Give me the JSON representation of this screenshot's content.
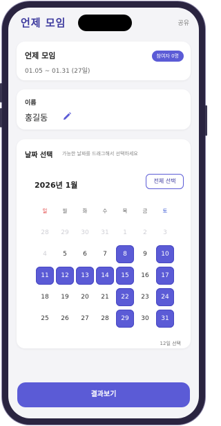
{
  "app": {
    "logo": "언제 모임",
    "share_label": "공유"
  },
  "event": {
    "title": "언제 모임",
    "range": "01.05 ~ 01.31 (27일)",
    "participants_badge": "참여자 0명"
  },
  "name": {
    "label": "이름",
    "value": "홍길동"
  },
  "date_select": {
    "title": "날짜 선택",
    "hint": "가능한 날짜를 드래그해서 선택하세요",
    "month": "2026년 1월",
    "select_all_label": "전체 선택",
    "weekdays": [
      "일",
      "월",
      "화",
      "수",
      "목",
      "금",
      "토"
    ],
    "weeks": [
      [
        {
          "d": "28",
          "state": "faded"
        },
        {
          "d": "29",
          "state": "faded"
        },
        {
          "d": "30",
          "state": "faded"
        },
        {
          "d": "31",
          "state": "faded"
        },
        {
          "d": "1",
          "state": "faded"
        },
        {
          "d": "2",
          "state": "faded"
        },
        {
          "d": "3",
          "state": "faded"
        }
      ],
      [
        {
          "d": "4",
          "state": "faded"
        },
        {
          "d": "5",
          "state": "normal"
        },
        {
          "d": "6",
          "state": "normal"
        },
        {
          "d": "7",
          "state": "normal"
        },
        {
          "d": "8",
          "state": "selected"
        },
        {
          "d": "9",
          "state": "normal"
        },
        {
          "d": "10",
          "state": "selected"
        }
      ],
      [
        {
          "d": "11",
          "state": "selected"
        },
        {
          "d": "12",
          "state": "selected"
        },
        {
          "d": "13",
          "state": "selected"
        },
        {
          "d": "14",
          "state": "selected"
        },
        {
          "d": "15",
          "state": "selected"
        },
        {
          "d": "16",
          "state": "normal"
        },
        {
          "d": "17",
          "state": "selected"
        }
      ],
      [
        {
          "d": "18",
          "state": "normal"
        },
        {
          "d": "19",
          "state": "normal"
        },
        {
          "d": "20",
          "state": "normal"
        },
        {
          "d": "21",
          "state": "normal"
        },
        {
          "d": "22",
          "state": "selected"
        },
        {
          "d": "23",
          "state": "normal"
        },
        {
          "d": "24",
          "state": "selected"
        }
      ],
      [
        {
          "d": "25",
          "state": "normal"
        },
        {
          "d": "26",
          "state": "normal"
        },
        {
          "d": "27",
          "state": "normal"
        },
        {
          "d": "28",
          "state": "normal"
        },
        {
          "d": "29",
          "state": "selected"
        },
        {
          "d": "30",
          "state": "normal"
        },
        {
          "d": "31",
          "state": "selected"
        }
      ]
    ],
    "selected_count_label": "12일 선택"
  },
  "cta_label": "결과보기",
  "colors": {
    "accent": "#5b5bd6",
    "logo": "#3d3a9e",
    "sunday": "#e14040",
    "saturday": "#3d5bd6"
  },
  "icons": {
    "edit": "pencil-icon"
  }
}
